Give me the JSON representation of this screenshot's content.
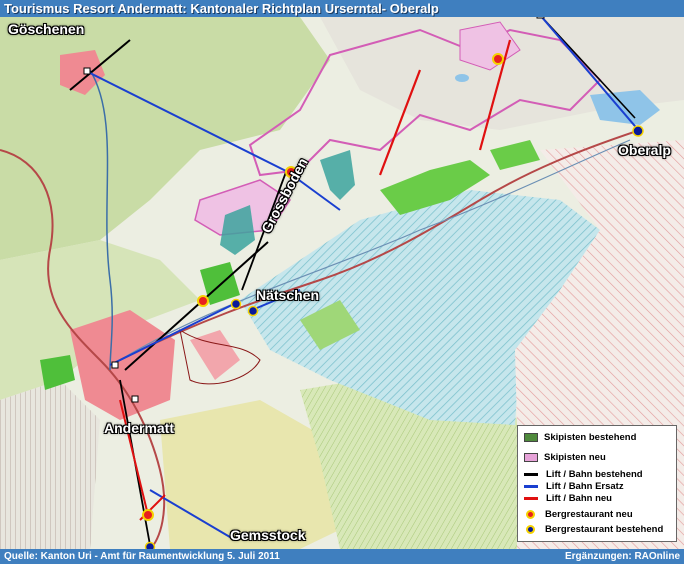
{
  "title": "Tourismus Resort Andermatt: Kantonaler Richtplan Urserntal- Oberalp",
  "places": {
    "goeschenen": "Göschenen",
    "oberalp": "Oberalp",
    "grossboden": "Grossboden",
    "naetschen": "Nätschen",
    "andermatt": "Andermatt",
    "gemsstock": "Gemsstock"
  },
  "legend": {
    "pistes_existing": "Skipisten bestehend",
    "pistes_new": "Skipisten neu",
    "lift_existing": "Lift / Bahn bestehend",
    "lift_replacement": "Lift / Bahn Ersatz",
    "lift_new": "Lift / Bahn neu",
    "restaurant_new": "Bergrestaurant neu",
    "restaurant_existing": "Bergrestaurant bestehend"
  },
  "colors": {
    "pistes_existing": "#4f8a3c",
    "pistes_new": "#e6a2d8",
    "lift_existing": "#000000",
    "lift_replacement": "#1a3fd0",
    "lift_new": "#e01010",
    "restaurant_new": "#e82020",
    "restaurant_existing": "#0a1a9a"
  },
  "footer": {
    "source": "Quelle: Kanton Uri - Amt für Raumentwicklung 5. Juli 2011",
    "additions": "Ergänzungen: RAOnline"
  }
}
